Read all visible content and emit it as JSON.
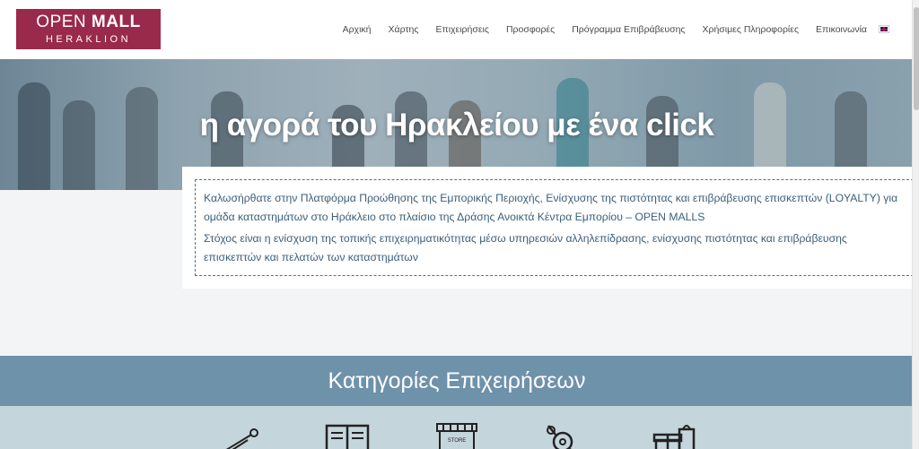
{
  "header": {
    "logo_line1_light": "OPEN ",
    "logo_line1_bold": "MALL",
    "logo_line2": "HERAKLION",
    "nav": [
      "Αρχική",
      "Χάρτης",
      "Επιχειρήσεις",
      "Προσφορές",
      "Πρόγραμμα Επιβράβευσης",
      "Χρήσιμες Πληροφορίες",
      "Επικοινωνία"
    ],
    "language_icon": "uk-flag-icon"
  },
  "hero": {
    "title": "η αγορά του Ηρακλείου με ένα click"
  },
  "intro": {
    "paragraph1": "Καλωσήρθατε στην Πλατφόρμα Προώθησης της Εμπορικής Περιοχής, Ενίσχυσης της πιστότητας και επιβράβευσης επισκεπτών (LOYALTY) για ομάδα καταστημάτων στο Ηράκλειο στο πλαίσιο της Δράσης Ανοικτά Κέντρα Εμπορίου – OPEN MALLS",
    "paragraph2": "Στόχος είναι η ενίσχυση της τοπικής επιχειρηματικότητας μέσω υπηρεσιών αλληλεπίδρασης, ενίσχυσης πιστότητας και επιβράβευσης επισκεπτών και πελατών των καταστημάτων"
  },
  "categories": {
    "title": "Κατηγορίες Επιχειρήσεων",
    "icons": [
      "safety-pin-icon",
      "book-icon",
      "store-icon",
      "candy-icon",
      "gift-icon"
    ],
    "store_sign": "STORE"
  },
  "colors": {
    "logo_bg": "#9a2a4b",
    "intro_text": "#3b5f7c",
    "category_band": "#6f92ab",
    "category_area": "#c5d5dc"
  }
}
